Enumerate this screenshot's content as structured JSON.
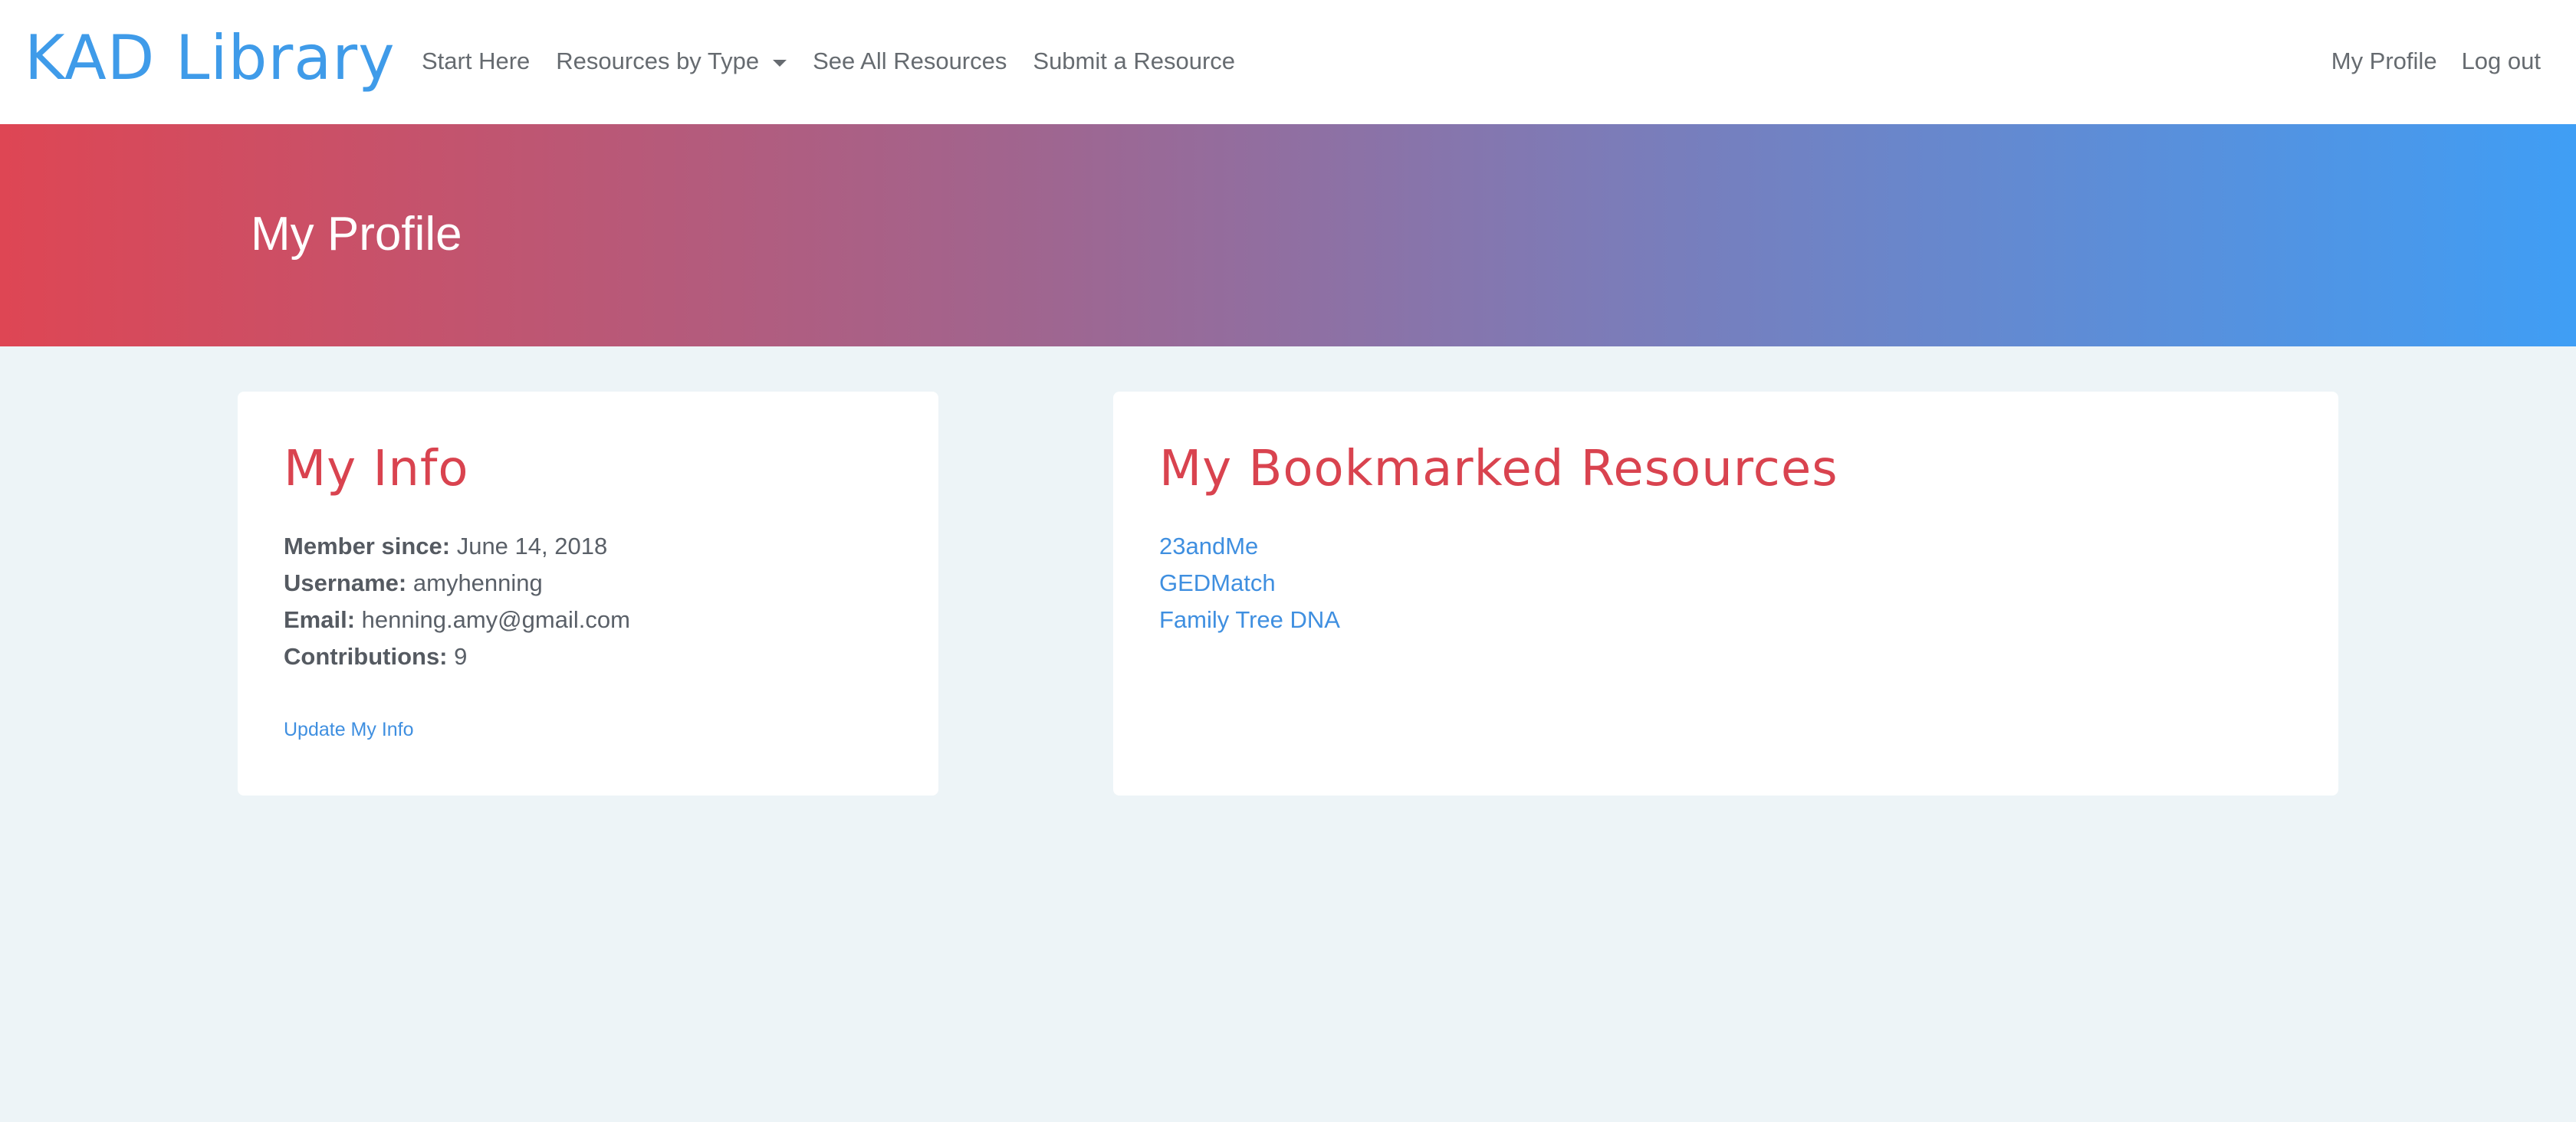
{
  "navbar": {
    "brand": "KAD Library",
    "links": [
      {
        "label": "Start Here"
      },
      {
        "label": "Resources by Type"
      },
      {
        "label": "See All Resources"
      },
      {
        "label": "Submit a Resource"
      }
    ],
    "right_links": [
      {
        "label": "My Profile"
      },
      {
        "label": "Log out"
      }
    ]
  },
  "hero": {
    "title": "My Profile"
  },
  "info_card": {
    "title": "My Info",
    "fields": [
      {
        "label": "Member since:",
        "value": "June 14, 2018"
      },
      {
        "label": "Username:",
        "value": "amyhenning"
      },
      {
        "label": "Email:",
        "value": "henning.amy@gmail.com"
      },
      {
        "label": "Contributions:",
        "value": "9"
      }
    ],
    "update_link": "Update My Info"
  },
  "bookmarks_card": {
    "title": "My Bookmarked Resources",
    "items": [
      {
        "label": "23andMe"
      },
      {
        "label": "GEDMatch"
      },
      {
        "label": "Family Tree DNA"
      }
    ]
  },
  "colors": {
    "brand": "#3f9be9",
    "accent_red": "#d9434f",
    "link": "#3f8fe0",
    "page_bg": "#edf4f7"
  }
}
